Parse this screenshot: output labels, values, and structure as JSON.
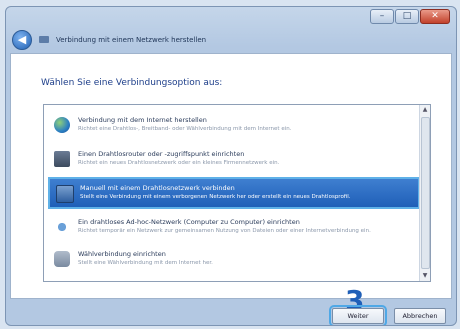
{
  "window": {
    "title": "Verbindung mit einem Netzwerk herstellen",
    "controls": {
      "minimize": "–",
      "maximize": "□",
      "close": "✕"
    }
  },
  "heading": "Wählen Sie eine Verbindungsoption aus:",
  "options": [
    {
      "title": "Verbindung mit dem Internet herstellen",
      "desc": "Richtet eine Drahtlos-, Breitband- oder Wählverbindung mit dem Internet ein."
    },
    {
      "title": "Einen Drahtlosrouter oder -zugriffspunkt einrichten",
      "desc": "Richtet ein neues Drahtlosnetzwerk oder ein kleines Firmennetzwerk ein."
    },
    {
      "title": "Manuell mit einem Drahtlosnetzwerk verbinden",
      "desc": "Stellt eine Verbindung mit einem verborgenen Netzwerk her oder erstellt ein neues Drahtlosprofil."
    },
    {
      "title": "Ein drahtloses Ad-hoc-Netzwerk (Computer zu Computer) einrichten",
      "desc": "Richtet temporär ein Netzwerk zur gemeinsamen Nutzung von Dateien oder einer Internetverbindung ein."
    },
    {
      "title": "Wählverbindung einrichten",
      "desc": "Stellt eine Wählverbindung mit dem Internet her."
    }
  ],
  "step_marker": "3",
  "buttons": {
    "next": "Weiter",
    "cancel": "Abbrechen"
  },
  "colors": {
    "selection": "#1f5fb8",
    "highlight": "#5fb1e8",
    "step": "#1f5fb8"
  }
}
